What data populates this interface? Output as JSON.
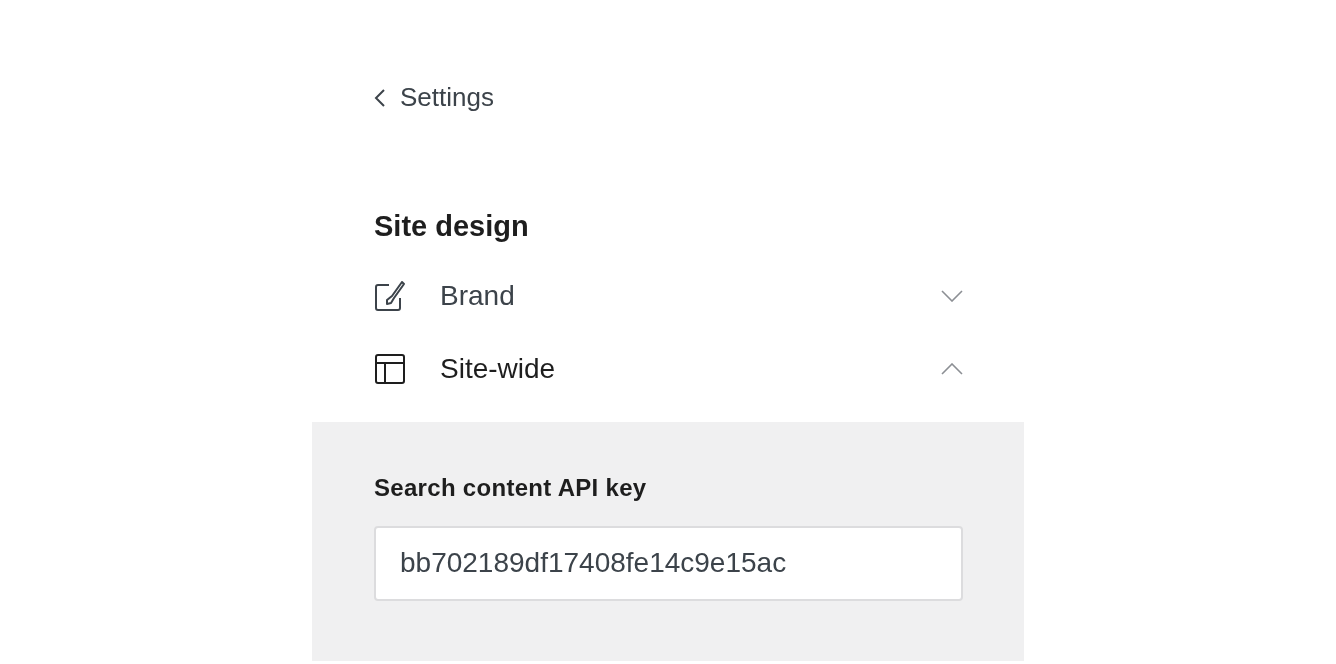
{
  "back_link": {
    "label": "Settings"
  },
  "section": {
    "title": "Site design",
    "items": [
      {
        "label": "Brand",
        "kind": "brush",
        "expanded": false
      },
      {
        "label": "Site-wide",
        "kind": "layout",
        "expanded": true,
        "fields": [
          {
            "label": "Search content API key",
            "value": "bb702189df17408fe14c9e15ac"
          }
        ]
      }
    ]
  }
}
